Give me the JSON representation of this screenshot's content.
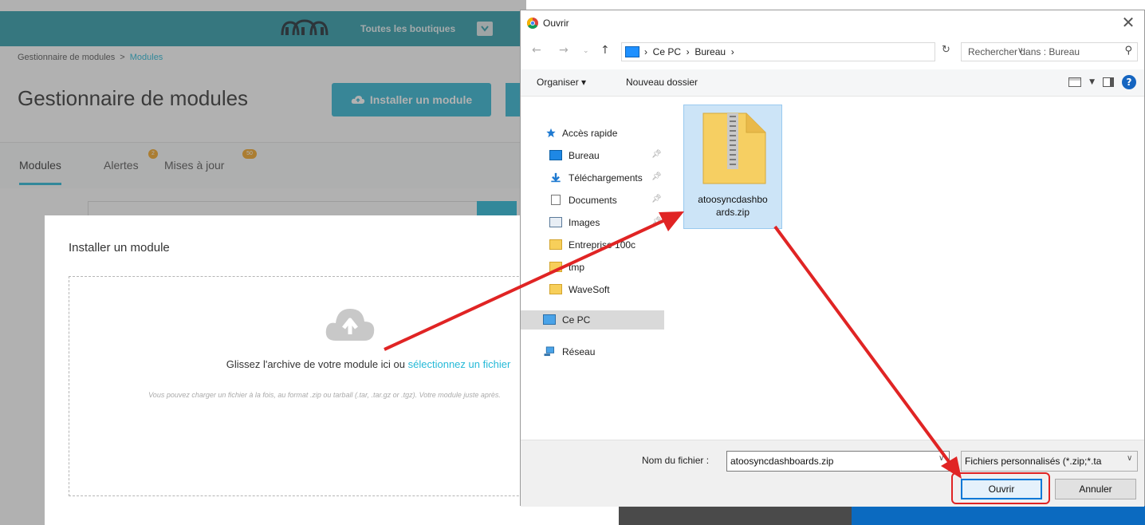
{
  "background": {
    "topbar": {
      "shop_selector_label": "Toutes les boutiques"
    },
    "breadcrumb": {
      "parent": "Gestionnaire de modules",
      "separator": ">",
      "current": "Modules"
    },
    "page_title": "Gestionnaire de modules",
    "install_button_label": "Installer un module",
    "tabs": [
      {
        "label": "Modules",
        "badge": ""
      },
      {
        "label": "Alertes",
        "badge": "2"
      },
      {
        "label": "Mises à jour",
        "badge": "50"
      }
    ]
  },
  "modal": {
    "title": "Installer un module",
    "drop_text": "Glissez l'archive de votre module ici ou ",
    "drop_link": "sélectionnez un fichier",
    "hint": "Vous pouvez charger un fichier à la fois, au format .zip ou tarball (.tar, .tar.gz or .tgz). Votre module juste après."
  },
  "dialog": {
    "title": "Ouvrir",
    "close_glyph": "✕",
    "address": "›  Ce PC  ›  Bureau  ›",
    "search_placeholder": "Rechercher dans : Bureau",
    "toolbar": {
      "organize": "Organiser ▾",
      "new_folder": "Nouveau dossier"
    },
    "nav_items": [
      {
        "label": "Accès rapide",
        "icon": "star-icon",
        "pinned": false
      },
      {
        "label": "Bureau",
        "icon": "desktop-icon",
        "pinned": true
      },
      {
        "label": "Téléchargements",
        "icon": "download-icon",
        "pinned": true
      },
      {
        "label": "Documents",
        "icon": "documents-icon",
        "pinned": true
      },
      {
        "label": "Images",
        "icon": "images-icon",
        "pinned": true
      },
      {
        "label": "Entreprise 100c",
        "icon": "folder-icon",
        "pinned": false
      },
      {
        "label": "tmp",
        "icon": "folder-icon",
        "pinned": false
      },
      {
        "label": "WaveSoft",
        "icon": "folder-icon",
        "pinned": false
      },
      {
        "label": "Ce PC",
        "icon": "computer-icon",
        "pinned": false
      },
      {
        "label": "Réseau",
        "icon": "network-icon",
        "pinned": false
      }
    ],
    "file": {
      "name_line1": "atoosyncdashbo",
      "name_line2": "ards.zip"
    },
    "filename_label": "Nom du fichier :",
    "filename_value": "atoosyncdashboards.zip",
    "filetype_value": "Fichiers personnalisés (*.zip;*.ta",
    "open_label": "Ouvrir",
    "cancel_label": "Annuler"
  },
  "colors": {
    "prestashop_teal": "#2c9baa",
    "prestashop_blue": "#2fb5d2",
    "link_blue": "#25b9d7",
    "annotation_red": "#e02424",
    "windows_accent": "#0078d7"
  }
}
